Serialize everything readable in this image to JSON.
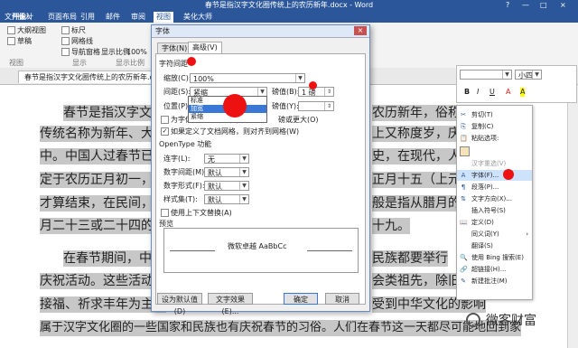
{
  "window": {
    "title": "春节是指汉字文化圈传统上的农历新年.docx - Word",
    "controls": [
      "?",
      "—",
      "□",
      "×"
    ]
  },
  "ribbon_tabs": [
    "文件",
    "开始",
    "插入",
    "设计",
    "页面布局",
    "引用",
    "邮件",
    "审阅",
    "视图",
    "美化大师"
  ],
  "ribbon": {
    "checks": [
      "大纲视图",
      "标尺",
      "草稿",
      "网格线",
      "导航窗格"
    ],
    "buttons": [
      "显示比例",
      "100%"
    ],
    "groups": [
      "视图",
      "显示",
      "显示比例"
    ]
  },
  "doc_tab": {
    "name": "春节是指汉字文化圈传统上的农历新年.docx",
    "close": "×"
  },
  "document": {
    "lines": [
      "春节是指汉字文",
      "传统名称为新年、大年",
      "中。中国人过春节已有",
      "定于农历正月初一，但",
      "才算结束，在民间，传统",
      "月二十三或二十四的祭",
      "在春节期间，中国",
      "庆祝活动。这些活动均",
      "接福、祈求丰年为主要",
      "属于汉字文化圈的一些国家和民族也有庆祝春节的习俗。人们在春节这一天都尽可能地回到家"
    ],
    "right_lines": [
      "农历新年，俗称“年",
      "上又称度岁，庆新岁",
      "史，在现代，人们把",
      "正月十五（上元节）",
      "般是指从腊月的腊祭",
      "十九。",
      "民族都要举行",
      "会类祖先，除旧布新",
      "受到中华文化的影响"
    ]
  },
  "dialog": {
    "title": "字体",
    "close": "×",
    "tabs": [
      "字体(N)",
      "高级(V)"
    ],
    "section_spacing": "字符间距",
    "scale_label": "缩放(C):",
    "scale_value": "100%",
    "spacing_label": "间距(S):",
    "spacing_value": "紧缩",
    "by1_label": "磅值(B):",
    "by1_value": "1 磅",
    "position_label": "位置(P):",
    "by2_label": "磅值(Y):",
    "spacing_options": [
      "标准",
      "加宽",
      "紧缩"
    ],
    "kerning_check": "为字体调整字间距(K):",
    "kerning_tail": "磅或更大(O)",
    "grid_check": "如果定义了文档网格，则对齐到网格(W)",
    "section_opentype": "OpenType 功能",
    "ligature_label": "连字(L):",
    "ligature_value": "无",
    "numspacing_label": "数字间距(M):",
    "numspacing_value": "默认",
    "numform_label": "数字形式(F):",
    "numform_value": "默认",
    "styleset_label": "样式集(T):",
    "styleset_value": "默认",
    "contextual_check": "使用上下文替换(A)",
    "section_preview": "预览",
    "preview_text": "微软卓越 AaBbCc",
    "btn_default": "设为默认值(D)",
    "btn_effects": "文字效果(E)...",
    "btn_ok": "确定",
    "btn_cancel": "取消"
  },
  "mini_toolbar": {
    "font": "",
    "size": "小四",
    "row2": [
      "B",
      "I",
      "U",
      "A",
      "A"
    ]
  },
  "context_menu": [
    {
      "icon": "✂",
      "label": "剪切(T)"
    },
    {
      "icon": "⎘",
      "label": "复制(C)"
    },
    {
      "icon": "📋",
      "label": "粘贴选项:"
    },
    {
      "icon": "",
      "label": ""
    },
    {
      "icon": "",
      "label": "汉字重选(V)",
      "dim": true
    },
    {
      "icon": "A",
      "label": "字体(F)...",
      "hover": true
    },
    {
      "icon": "¶",
      "label": "段落(P)..."
    },
    {
      "icon": "⇅",
      "label": "文字方向(X)..."
    },
    {
      "icon": "",
      "label": "插入符号(S)"
    },
    {
      "icon": "📖",
      "label": "定义(D)"
    },
    {
      "icon": "",
      "label": "同义词(Y)"
    },
    {
      "icon": "",
      "label": "翻译(S)"
    },
    {
      "icon": "🔍",
      "label": "使用 Bing 搜索(E)"
    },
    {
      "icon": "🔗",
      "label": "超链接(H)..."
    },
    {
      "icon": "✎",
      "label": "新建批注(M)"
    }
  ],
  "watermark": "微客财富",
  "accent": "#2b579a",
  "marker_color": "#ee1111"
}
